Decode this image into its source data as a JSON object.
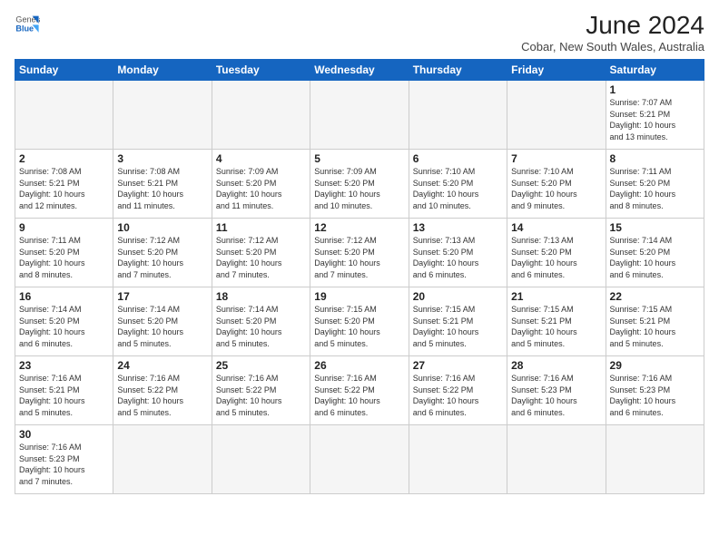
{
  "header": {
    "logo_general": "General",
    "logo_blue": "Blue",
    "month_title": "June 2024",
    "location": "Cobar, New South Wales, Australia"
  },
  "weekdays": [
    "Sunday",
    "Monday",
    "Tuesday",
    "Wednesday",
    "Thursday",
    "Friday",
    "Saturday"
  ],
  "weeks": [
    [
      {
        "day": "",
        "info": ""
      },
      {
        "day": "",
        "info": ""
      },
      {
        "day": "",
        "info": ""
      },
      {
        "day": "",
        "info": ""
      },
      {
        "day": "",
        "info": ""
      },
      {
        "day": "",
        "info": ""
      },
      {
        "day": "1",
        "info": "Sunrise: 7:07 AM\nSunset: 5:21 PM\nDaylight: 10 hours\nand 13 minutes."
      }
    ],
    [
      {
        "day": "2",
        "info": "Sunrise: 7:08 AM\nSunset: 5:21 PM\nDaylight: 10 hours\nand 12 minutes."
      },
      {
        "day": "3",
        "info": "Sunrise: 7:08 AM\nSunset: 5:21 PM\nDaylight: 10 hours\nand 11 minutes."
      },
      {
        "day": "4",
        "info": "Sunrise: 7:09 AM\nSunset: 5:20 PM\nDaylight: 10 hours\nand 11 minutes."
      },
      {
        "day": "5",
        "info": "Sunrise: 7:09 AM\nSunset: 5:20 PM\nDaylight: 10 hours\nand 10 minutes."
      },
      {
        "day": "6",
        "info": "Sunrise: 7:10 AM\nSunset: 5:20 PM\nDaylight: 10 hours\nand 10 minutes."
      },
      {
        "day": "7",
        "info": "Sunrise: 7:10 AM\nSunset: 5:20 PM\nDaylight: 10 hours\nand 9 minutes."
      },
      {
        "day": "8",
        "info": "Sunrise: 7:11 AM\nSunset: 5:20 PM\nDaylight: 10 hours\nand 8 minutes."
      }
    ],
    [
      {
        "day": "9",
        "info": "Sunrise: 7:11 AM\nSunset: 5:20 PM\nDaylight: 10 hours\nand 8 minutes."
      },
      {
        "day": "10",
        "info": "Sunrise: 7:12 AM\nSunset: 5:20 PM\nDaylight: 10 hours\nand 7 minutes."
      },
      {
        "day": "11",
        "info": "Sunrise: 7:12 AM\nSunset: 5:20 PM\nDaylight: 10 hours\nand 7 minutes."
      },
      {
        "day": "12",
        "info": "Sunrise: 7:12 AM\nSunset: 5:20 PM\nDaylight: 10 hours\nand 7 minutes."
      },
      {
        "day": "13",
        "info": "Sunrise: 7:13 AM\nSunset: 5:20 PM\nDaylight: 10 hours\nand 6 minutes."
      },
      {
        "day": "14",
        "info": "Sunrise: 7:13 AM\nSunset: 5:20 PM\nDaylight: 10 hours\nand 6 minutes."
      },
      {
        "day": "15",
        "info": "Sunrise: 7:14 AM\nSunset: 5:20 PM\nDaylight: 10 hours\nand 6 minutes."
      }
    ],
    [
      {
        "day": "16",
        "info": "Sunrise: 7:14 AM\nSunset: 5:20 PM\nDaylight: 10 hours\nand 6 minutes."
      },
      {
        "day": "17",
        "info": "Sunrise: 7:14 AM\nSunset: 5:20 PM\nDaylight: 10 hours\nand 5 minutes."
      },
      {
        "day": "18",
        "info": "Sunrise: 7:14 AM\nSunset: 5:20 PM\nDaylight: 10 hours\nand 5 minutes."
      },
      {
        "day": "19",
        "info": "Sunrise: 7:15 AM\nSunset: 5:20 PM\nDaylight: 10 hours\nand 5 minutes."
      },
      {
        "day": "20",
        "info": "Sunrise: 7:15 AM\nSunset: 5:21 PM\nDaylight: 10 hours\nand 5 minutes."
      },
      {
        "day": "21",
        "info": "Sunrise: 7:15 AM\nSunset: 5:21 PM\nDaylight: 10 hours\nand 5 minutes."
      },
      {
        "day": "22",
        "info": "Sunrise: 7:15 AM\nSunset: 5:21 PM\nDaylight: 10 hours\nand 5 minutes."
      }
    ],
    [
      {
        "day": "23",
        "info": "Sunrise: 7:16 AM\nSunset: 5:21 PM\nDaylight: 10 hours\nand 5 minutes."
      },
      {
        "day": "24",
        "info": "Sunrise: 7:16 AM\nSunset: 5:22 PM\nDaylight: 10 hours\nand 5 minutes."
      },
      {
        "day": "25",
        "info": "Sunrise: 7:16 AM\nSunset: 5:22 PM\nDaylight: 10 hours\nand 5 minutes."
      },
      {
        "day": "26",
        "info": "Sunrise: 7:16 AM\nSunset: 5:22 PM\nDaylight: 10 hours\nand 6 minutes."
      },
      {
        "day": "27",
        "info": "Sunrise: 7:16 AM\nSunset: 5:22 PM\nDaylight: 10 hours\nand 6 minutes."
      },
      {
        "day": "28",
        "info": "Sunrise: 7:16 AM\nSunset: 5:23 PM\nDaylight: 10 hours\nand 6 minutes."
      },
      {
        "day": "29",
        "info": "Sunrise: 7:16 AM\nSunset: 5:23 PM\nDaylight: 10 hours\nand 6 minutes."
      }
    ],
    [
      {
        "day": "30",
        "info": "Sunrise: 7:16 AM\nSunset: 5:23 PM\nDaylight: 10 hours\nand 7 minutes."
      },
      {
        "day": "",
        "info": ""
      },
      {
        "day": "",
        "info": ""
      },
      {
        "day": "",
        "info": ""
      },
      {
        "day": "",
        "info": ""
      },
      {
        "day": "",
        "info": ""
      },
      {
        "day": "",
        "info": ""
      }
    ]
  ]
}
